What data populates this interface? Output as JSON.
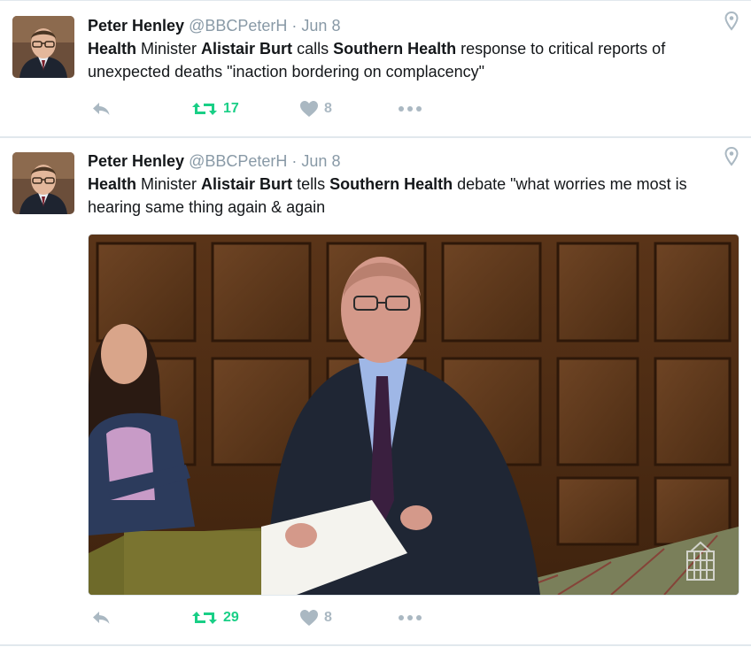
{
  "tweets": [
    {
      "fullname": "Peter Henley",
      "handle": "@BBCPeterH",
      "separator": "·",
      "time": "Jun 8",
      "text_parts": [
        {
          "t": "Health",
          "bold": true
        },
        {
          "t": " Minister ",
          "bold": false
        },
        {
          "t": "Alistair Burt",
          "bold": true
        },
        {
          "t": " calls ",
          "bold": false
        },
        {
          "t": "Southern Health",
          "bold": true
        },
        {
          "t": " response to critical reports of unexpected deaths  \"inaction bordering on complacency\"",
          "bold": false
        }
      ],
      "retweets": "17",
      "likes": "8",
      "has_media": false
    },
    {
      "fullname": "Peter Henley",
      "handle": "@BBCPeterH",
      "separator": "·",
      "time": "Jun 8",
      "text_parts": [
        {
          "t": "Health",
          "bold": true
        },
        {
          "t": " Minister ",
          "bold": false
        },
        {
          "t": "Alistair Burt",
          "bold": true
        },
        {
          "t": " tells ",
          "bold": false
        },
        {
          "t": "Southern Health",
          "bold": true
        },
        {
          "t": " debate \"what worries me most is hearing same thing again & again",
          "bold": false
        }
      ],
      "retweets": "29",
      "likes": "8",
      "has_media": true
    }
  ],
  "icons": {
    "reply": "reply-icon",
    "retweet": "retweet-icon",
    "like": "heart-icon",
    "more": "more-icon",
    "geo": "location-pin-icon"
  },
  "colors": {
    "retweet_green": "#19cf86",
    "muted_gray": "#aab8c2",
    "handle_gray": "#8899a6"
  }
}
